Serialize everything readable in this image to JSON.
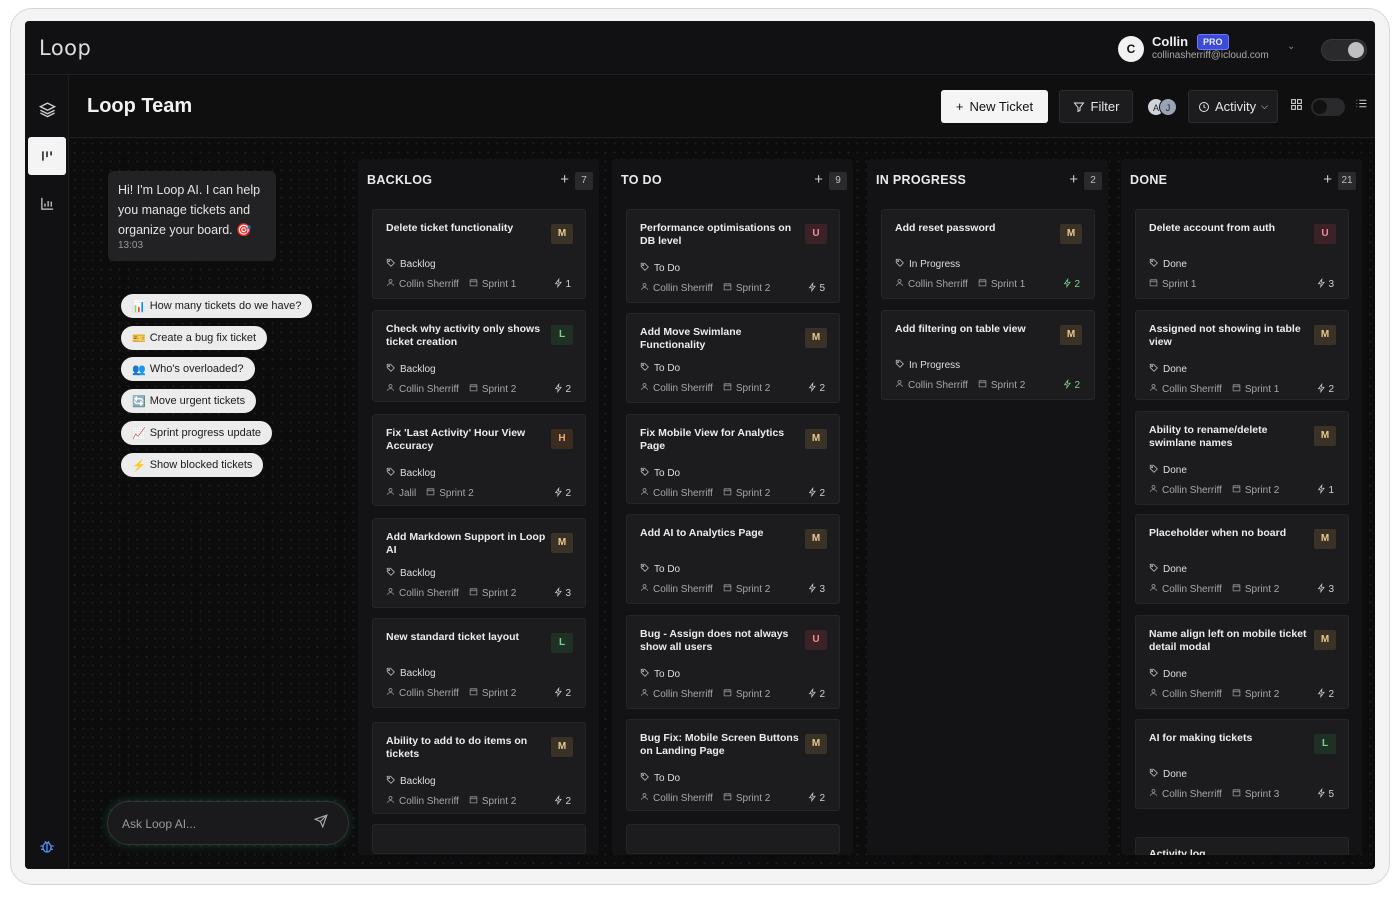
{
  "app": {
    "logo": "Loop"
  },
  "user": {
    "initial": "C",
    "name": "Collin",
    "badge": "PRO",
    "email": "collinasherriff@icloud.com"
  },
  "header": {
    "title": "Loop Team",
    "new_ticket": "New Ticket",
    "filter": "Filter",
    "activity": "Activity",
    "avatars": [
      "A",
      "J"
    ]
  },
  "ai": {
    "greeting": "Hi! I'm Loop AI. I can help you manage tickets and organize your board. 🎯",
    "time": "13:03",
    "suggestions": [
      {
        "icon": "📊",
        "label": "How many tickets do we have?"
      },
      {
        "icon": "🎫",
        "label": "Create a bug fix ticket"
      },
      {
        "icon": "👥",
        "label": "Who's overloaded?"
      },
      {
        "icon": "🔄",
        "label": "Move urgent tickets"
      },
      {
        "icon": "📈",
        "label": "Sprint progress update"
      },
      {
        "icon": "⚡",
        "label": "Show blocked tickets"
      }
    ],
    "placeholder": "Ask Loop AI..."
  },
  "columns": [
    {
      "title": "BACKLOG",
      "count": "7",
      "cards": [
        {
          "title": "Delete ticket functionality",
          "priority": "M",
          "status": "Backlog",
          "assignee": "Collin Sherriff",
          "sprint": "Sprint 1",
          "points": "1"
        },
        {
          "title": "Check why activity only shows ticket creation",
          "priority": "L",
          "status": "Backlog",
          "assignee": "Collin Sherriff",
          "sprint": "Sprint 2",
          "points": "2"
        },
        {
          "title": "Fix 'Last Activity' Hour View Accuracy",
          "priority": "H",
          "status": "Backlog",
          "assignee": "Jalil",
          "sprint": "Sprint 2",
          "points": "2"
        },
        {
          "title": "Add Markdown Support in Loop AI",
          "priority": "M",
          "status": "Backlog",
          "assignee": "Collin Sherriff",
          "sprint": "Sprint 2",
          "points": "3"
        },
        {
          "title": "New standard ticket layout",
          "priority": "L",
          "status": "Backlog",
          "assignee": "Collin Sherriff",
          "sprint": "Sprint 2",
          "points": "2"
        },
        {
          "title": "Ability to add to do items on tickets",
          "priority": "M",
          "status": "Backlog",
          "assignee": "Collin Sherriff",
          "sprint": "Sprint 2",
          "points": "2"
        }
      ]
    },
    {
      "title": "TO DO",
      "count": "9",
      "cards": [
        {
          "title": "Performance optimisations on DB level",
          "priority": "U",
          "status": "To Do",
          "assignee": "Collin Sherriff",
          "sprint": "Sprint 2",
          "points": "5"
        },
        {
          "title": "Add Move Swimlane Functionality",
          "priority": "M",
          "status": "To Do",
          "assignee": "Collin Sherriff",
          "sprint": "Sprint 2",
          "points": "2"
        },
        {
          "title": "Fix Mobile View for Analytics Page",
          "priority": "M",
          "status": "To Do",
          "assignee": "Collin Sherriff",
          "sprint": "Sprint 2",
          "points": "2"
        },
        {
          "title": "Add AI to Analytics Page",
          "priority": "M",
          "status": "To Do",
          "assignee": "Collin Sherriff",
          "sprint": "Sprint 2",
          "points": "3"
        },
        {
          "title": "Bug - Assign does not always show all users",
          "priority": "U",
          "status": "To Do",
          "assignee": "Collin Sherriff",
          "sprint": "Sprint 2",
          "points": "2"
        },
        {
          "title": "Bug Fix: Mobile Screen Buttons on Landing Page",
          "priority": "M",
          "status": "To Do",
          "assignee": "Collin Sherriff",
          "sprint": "Sprint 2",
          "points": "2"
        }
      ]
    },
    {
      "title": "IN PROGRESS",
      "count": "2",
      "cards": [
        {
          "title": "Add reset password",
          "priority": "M",
          "status": "In Progress",
          "assignee": "Collin Sherriff",
          "sprint": "Sprint 1",
          "points": "2"
        },
        {
          "title": "Add filtering on table view",
          "priority": "M",
          "status": "In Progress",
          "assignee": "Collin Sherriff",
          "sprint": "Sprint 2",
          "points": "2"
        }
      ]
    },
    {
      "title": "DONE",
      "count": "21",
      "cards": [
        {
          "title": "Delete account from auth",
          "priority": "U",
          "status": "Done",
          "assignee": "",
          "sprint": "Sprint 1",
          "points": "3"
        },
        {
          "title": "Assigned not showing in table view",
          "priority": "M",
          "status": "Done",
          "assignee": "Collin Sherriff",
          "sprint": "Sprint 1",
          "points": "2"
        },
        {
          "title": "Ability to rename/delete swimlane names",
          "priority": "M",
          "status": "Done",
          "assignee": "Collin Sherriff",
          "sprint": "Sprint 2",
          "points": "1"
        },
        {
          "title": "Placeholder when no board",
          "priority": "M",
          "status": "Done",
          "assignee": "Collin Sherriff",
          "sprint": "Sprint 2",
          "points": "3"
        },
        {
          "title": "Name align left on mobile ticket detail modal",
          "priority": "M",
          "status": "Done",
          "assignee": "Collin Sherriff",
          "sprint": "Sprint 2",
          "points": "2"
        },
        {
          "title": "AI for making tickets",
          "priority": "L",
          "status": "Done",
          "assignee": "Collin Sherriff",
          "sprint": "Sprint 3",
          "points": "5"
        }
      ],
      "peek": "Activity log"
    }
  ]
}
